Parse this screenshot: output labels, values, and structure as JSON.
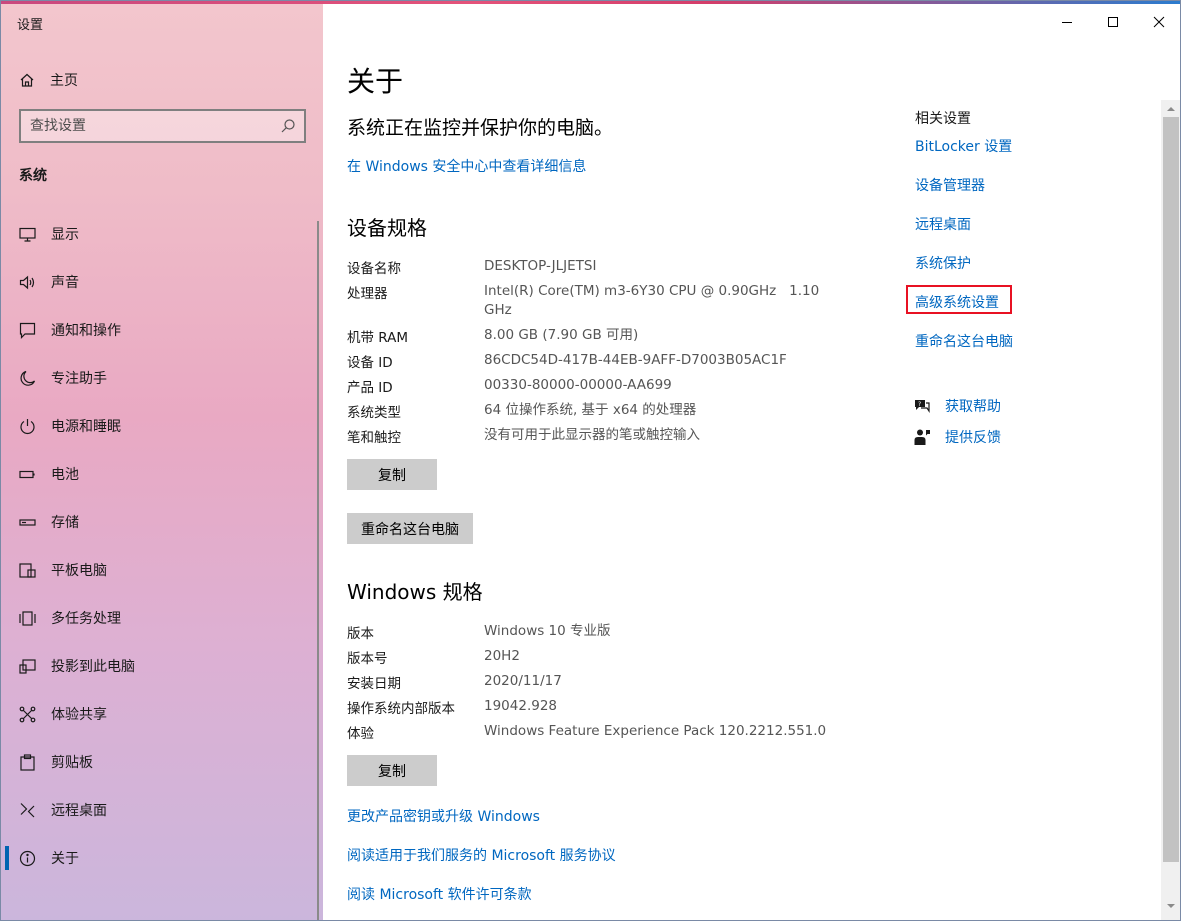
{
  "window": {
    "app_title": "设置",
    "controls": [
      "minimize",
      "maximize",
      "close"
    ]
  },
  "sidebar": {
    "home_label": "主页",
    "search_placeholder": "查找设置",
    "section_label": "系统",
    "items": [
      {
        "label": "显示",
        "icon": "monitor-icon"
      },
      {
        "label": "声音",
        "icon": "speaker-icon"
      },
      {
        "label": "通知和操作",
        "icon": "notification-icon"
      },
      {
        "label": "专注助手",
        "icon": "moon-icon"
      },
      {
        "label": "电源和睡眠",
        "icon": "power-icon"
      },
      {
        "label": "电池",
        "icon": "battery-icon"
      },
      {
        "label": "存储",
        "icon": "storage-icon"
      },
      {
        "label": "平板电脑",
        "icon": "tablet-icon"
      },
      {
        "label": "多任务处理",
        "icon": "multitask-icon"
      },
      {
        "label": "投影到此电脑",
        "icon": "project-icon"
      },
      {
        "label": "体验共享",
        "icon": "share-icon"
      },
      {
        "label": "剪贴板",
        "icon": "clipboard-icon"
      },
      {
        "label": "远程桌面",
        "icon": "remote-icon"
      },
      {
        "label": "关于",
        "icon": "info-icon",
        "selected": true
      }
    ]
  },
  "main": {
    "title": "关于",
    "protection_status": "系统正在监控并保护你的电脑。",
    "security_link": "在 Windows 安全中心中查看详细信息",
    "device_specs": {
      "heading": "设备规格",
      "rows": [
        {
          "label": "设备名称",
          "value": "DESKTOP-JLJETSI"
        },
        {
          "label": "处理器",
          "value": "Intel(R) Core(TM) m3-6Y30 CPU @ 0.90GHz   1.10",
          "value_line2": "GHz"
        },
        {
          "label": "机带 RAM",
          "value": "8.00 GB (7.90 GB 可用)"
        },
        {
          "label": "设备 ID",
          "value": "86CDC54D-417B-44EB-9AFF-D7003B05AC1F"
        },
        {
          "label": "产品 ID",
          "value": "00330-80000-00000-AA699"
        },
        {
          "label": "系统类型",
          "value": "64 位操作系统, 基于 x64 的处理器"
        },
        {
          "label": "笔和触控",
          "value": "没有可用于此显示器的笔或触控输入"
        }
      ],
      "copy_button": "复制",
      "rename_button": "重命名这台电脑"
    },
    "windows_specs": {
      "heading": "Windows 规格",
      "rows": [
        {
          "label": "版本",
          "value": "Windows 10 专业版"
        },
        {
          "label": "版本号",
          "value": "20H2"
        },
        {
          "label": "安装日期",
          "value": "2020/11/17"
        },
        {
          "label": "操作系统内部版本",
          "value": "19042.928"
        },
        {
          "label": "体验",
          "value": "Windows Feature Experience Pack 120.2212.551.0"
        }
      ],
      "copy_button": "复制"
    },
    "bottom_links": [
      "更改产品密钥或升级 Windows",
      "阅读适用于我们服务的 Microsoft 服务协议",
      "阅读 Microsoft 软件许可条款"
    ]
  },
  "related": {
    "title": "相关设置",
    "links": [
      "BitLocker 设置",
      "设备管理器",
      "远程桌面",
      "系统保护",
      "高级系统设置",
      "重命名这台电脑"
    ],
    "highlighted_index": 4,
    "help_label": "获取帮助",
    "feedback_label": "提供反馈"
  },
  "colors": {
    "link": "#0067c0",
    "accent": "#0063b1",
    "highlight_box": "#e81123"
  }
}
